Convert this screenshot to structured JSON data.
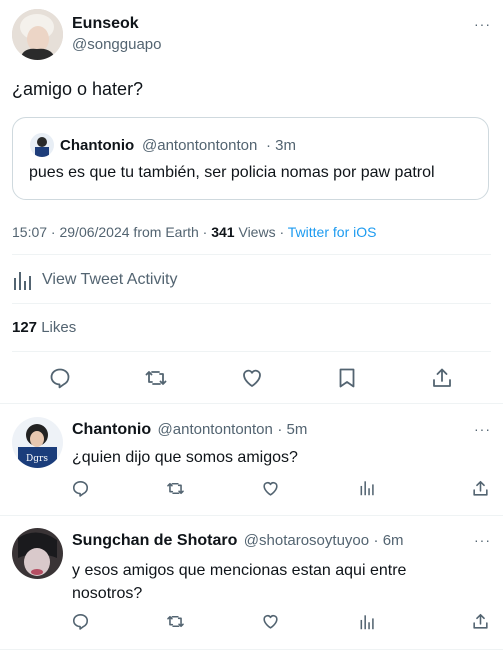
{
  "main_tweet": {
    "author_name": "Eunseok",
    "author_handle": "@songguapo",
    "text": "¿amigo o hater?",
    "quote": {
      "author_name": "Chantonio",
      "author_handle": "@antontontonton",
      "time": "· 3m",
      "text": "pues es que tu también, ser policia nomas por paw patrol"
    },
    "meta_time": "15:07 · 29/06/2024 from Earth ·",
    "views_count": "341",
    "views_label": "Views ·",
    "client": "Twitter for iOS",
    "activity_label": "View Tweet Activity",
    "likes_count": "127",
    "likes_label": "Likes"
  },
  "replies": [
    {
      "author_name": "Chantonio",
      "author_handle": "@antontontonton",
      "time": "· 5m",
      "text_line1": "¿quien dijo que somos amigos?",
      "text_line2": ""
    },
    {
      "author_name": "Sungchan de Shotaro",
      "author_handle": "@shotarosoytuyoo",
      "time": "· 6m",
      "text_line1": "y esos amigos que mencionas estan aqui entre",
      "text_line2": "nosotros?"
    }
  ],
  "more_glyph": "···",
  "colors": {
    "accent": "#1d9bf0",
    "muted": "#536471",
    "divider": "#eff3f4"
  }
}
